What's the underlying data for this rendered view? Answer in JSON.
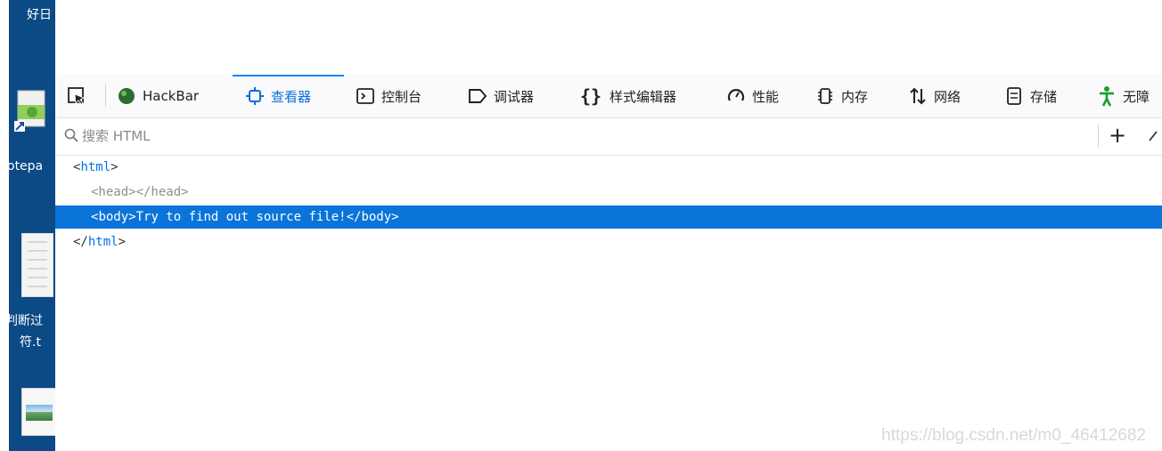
{
  "desktop": {
    "top_label": "好日",
    "notepad_label": "otepa",
    "file_label_line1": "判断过",
    "file_label_line2": "符.t"
  },
  "toolbar": {
    "pick_icon": "element-picker-icon",
    "hackbar": {
      "label": "HackBar",
      "icon": "hackbar-ball-icon"
    },
    "tabs": [
      {
        "label": "查看器",
        "icon": "inspector-icon",
        "selected": true
      },
      {
        "label": "控制台",
        "icon": "console-icon",
        "selected": false
      },
      {
        "label": "调试器",
        "icon": "debugger-icon",
        "selected": false
      },
      {
        "label": "样式编辑器",
        "icon": "style-editor-icon",
        "selected": false
      },
      {
        "label": "性能",
        "icon": "performance-icon",
        "selected": false
      },
      {
        "label": "内存",
        "icon": "memory-icon",
        "selected": false
      },
      {
        "label": "网络",
        "icon": "network-icon",
        "selected": false
      },
      {
        "label": "存储",
        "icon": "storage-icon",
        "selected": false
      },
      {
        "label": "无障",
        "icon": "accessibility-icon",
        "selected": false
      }
    ]
  },
  "search": {
    "placeholder": "搜索 HTML",
    "add_label": "+"
  },
  "tree": {
    "html_open": {
      "open": "<",
      "tag": "html",
      "close": ">"
    },
    "head": "<head></head>",
    "body": {
      "open": "<",
      "tag": "body",
      "text": ">Try to find out source file!</",
      "tag2": "body",
      "close": ">"
    },
    "html_close": {
      "open": "</",
      "tag": "html",
      "close": ">"
    }
  },
  "watermark": "https://blog.csdn.net/m0_46412682",
  "colors": {
    "accent": "#0a84ff",
    "selection": "#0a74da",
    "tag": "#0074e8",
    "desktop": "#0c4a86"
  }
}
